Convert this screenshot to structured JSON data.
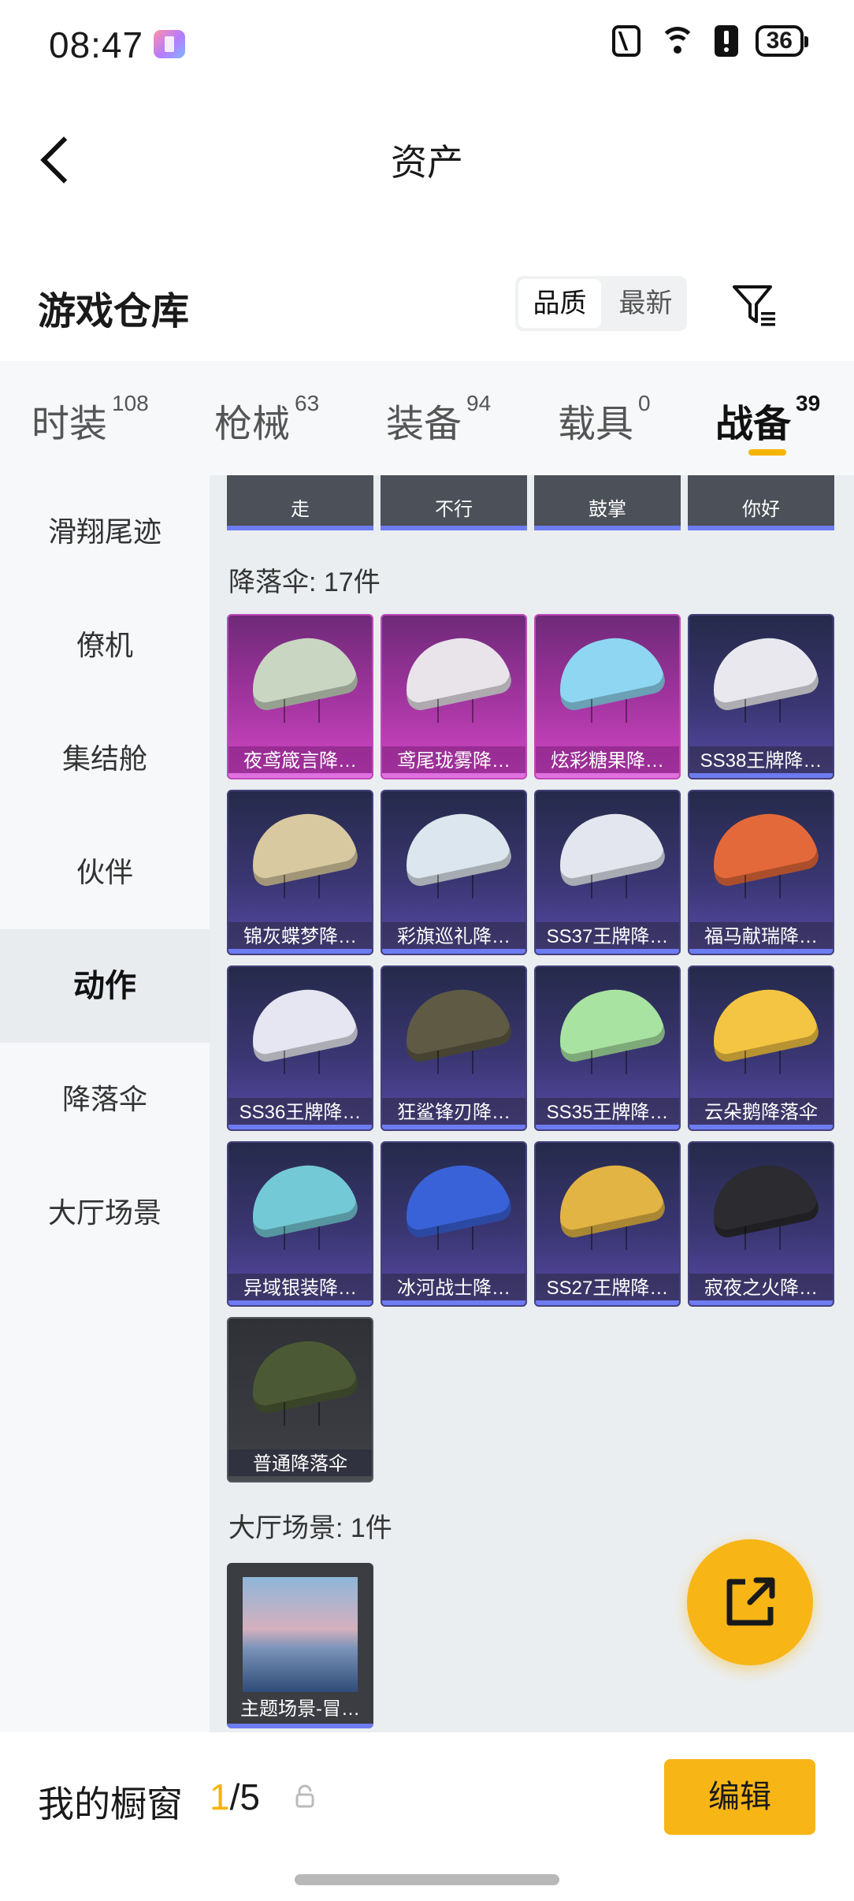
{
  "status_bar": {
    "time": "08:47",
    "battery": "36"
  },
  "header": {
    "title": "资产"
  },
  "warehouse": {
    "title": "游戏仓库",
    "sort_options": [
      "品质",
      "最新"
    ],
    "active_sort": "品质"
  },
  "tabs": [
    {
      "label": "时装",
      "count": "108"
    },
    {
      "label": "枪械",
      "count": "63"
    },
    {
      "label": "装备",
      "count": "94"
    },
    {
      "label": "载具",
      "count": "0"
    },
    {
      "label": "战备",
      "count": "39"
    }
  ],
  "active_tab": "战备",
  "sidebar": {
    "items": [
      "滑翔尾迹",
      "僚机",
      "集结舱",
      "伙伴",
      "动作",
      "降落伞",
      "大厅场景"
    ],
    "active": "动作"
  },
  "emotes": [
    "走",
    "不行",
    "鼓掌",
    "你好"
  ],
  "parachutes": {
    "title": "降落伞: 17件",
    "items": [
      {
        "name": "夜鸢箴言降…",
        "rarity": "pink",
        "color": "#c9d6c2"
      },
      {
        "name": "鸢尾珑雾降…",
        "rarity": "pink",
        "color": "#e9e3ea"
      },
      {
        "name": "炫彩糖果降…",
        "rarity": "pink",
        "color": "#8fd6f2"
      },
      {
        "name": "SS38王牌降…",
        "rarity": "purple",
        "color": "#e8e8ee"
      },
      {
        "name": "锦灰蝶梦降…",
        "rarity": "purple",
        "color": "#d9c9a0"
      },
      {
        "name": "彩旗巡礼降…",
        "rarity": "purple",
        "color": "#dce6ee"
      },
      {
        "name": "SS37王牌降…",
        "rarity": "purple",
        "color": "#e3e6ef"
      },
      {
        "name": "福马献瑞降…",
        "rarity": "purple",
        "color": "#e4693a"
      },
      {
        "name": "SS36王牌降…",
        "rarity": "purple",
        "color": "#e6e6f2"
      },
      {
        "name": "狂鲨锋刃降…",
        "rarity": "purple",
        "color": "#5e5a44"
      },
      {
        "name": "SS35王牌降…",
        "rarity": "purple",
        "color": "#a9e3a2"
      },
      {
        "name": "云朵鹅降落伞",
        "rarity": "purple",
        "color": "#f4c542"
      },
      {
        "name": "异域银装降…",
        "rarity": "purple",
        "color": "#74c9d6"
      },
      {
        "name": "冰河战士降…",
        "rarity": "purple",
        "color": "#3a62d8"
      },
      {
        "name": "SS27王牌降…",
        "rarity": "purple",
        "color": "#e2b444"
      },
      {
        "name": "寂夜之火降…",
        "rarity": "purple",
        "color": "#2b2b30"
      },
      {
        "name": "普通降落伞",
        "rarity": "grey",
        "color": "#4b5a34"
      }
    ]
  },
  "lobby_scene": {
    "title": "大厅场景: 1件",
    "items": [
      {
        "name": "主题场景-冒…"
      }
    ]
  },
  "bottom_bar": {
    "label": "我的橱窗",
    "current": "1",
    "total": "/5",
    "edit_label": "编辑"
  }
}
